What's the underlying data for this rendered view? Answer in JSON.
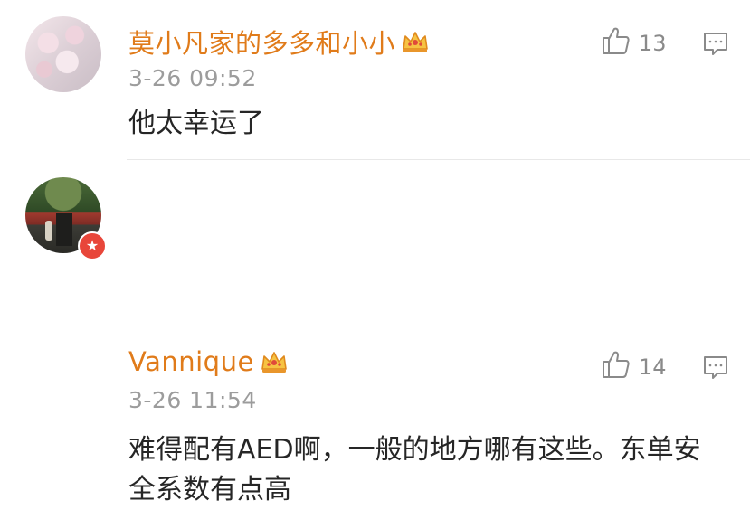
{
  "comments": [
    {
      "username": "莫小凡家的多多和小小",
      "time": "3-26 09:52",
      "text": "他太幸运了",
      "likes": "13",
      "icons": {
        "like": "thumbs-up-icon",
        "reply": "comment-bubble-icon",
        "badge": "crown-icon"
      }
    },
    {
      "username": "Vannique",
      "time": "3-26 11:54",
      "text": "难得配有AED啊，一般的地方哪有这些。东单安全系数有点高",
      "likes": "14",
      "icons": {
        "like": "thumbs-up-icon",
        "reply": "comment-bubble-icon",
        "badge": "crown-icon",
        "avatar_badge": "star-icon"
      }
    }
  ],
  "colors": {
    "username": "#e07b1a",
    "time": "#9c9c9c",
    "text": "#262626",
    "icon": "#8a8a8a",
    "badge_red": "#e8463a"
  }
}
